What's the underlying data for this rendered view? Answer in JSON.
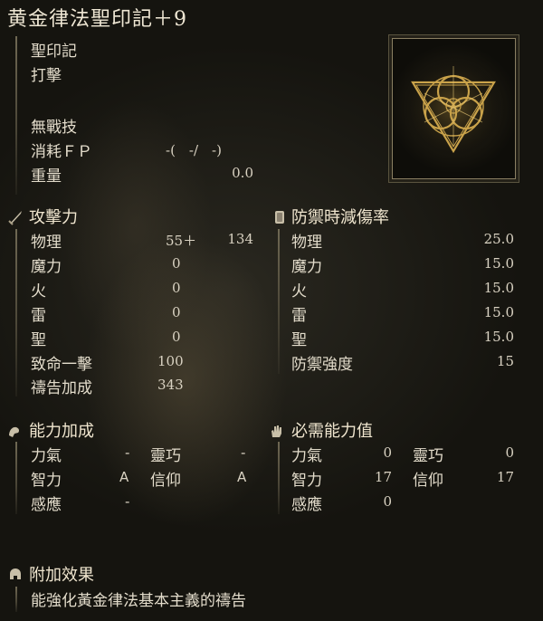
{
  "title": "黄金律法聖印記＋9",
  "item_info": {
    "type": "聖印記",
    "attack_type": "打擊",
    "skill": "無戰技",
    "fp_label": "消耗ＦＰ",
    "fp_value": "-(　-/　-)",
    "weight_label": "重量",
    "weight_value": "0.0"
  },
  "attack": {
    "header": "攻擊力",
    "rows": [
      {
        "label": "物理",
        "value": "55＋",
        "extra": "134"
      },
      {
        "label": "魔力",
        "value": "0"
      },
      {
        "label": "火",
        "value": "0"
      },
      {
        "label": "雷",
        "value": "0"
      },
      {
        "label": "聖",
        "value": "0"
      },
      {
        "label": "致命一擊",
        "value": "100"
      },
      {
        "label": "禱告加成",
        "value": "343"
      }
    ]
  },
  "defense": {
    "header": "防禦時減傷率",
    "rows": [
      {
        "label": "物理",
        "value": "25.0"
      },
      {
        "label": "魔力",
        "value": "15.0"
      },
      {
        "label": "火",
        "value": "15.0"
      },
      {
        "label": "雷",
        "value": "15.0"
      },
      {
        "label": "聖",
        "value": "15.0"
      },
      {
        "label": "防禦強度",
        "value": "15"
      }
    ]
  },
  "scaling": {
    "header": "能力加成",
    "rows": [
      {
        "l1": "力氣",
        "v1": "-",
        "l2": "靈巧",
        "v2": "-"
      },
      {
        "l1": "智力",
        "v1": "A",
        "l2": "信仰",
        "v2": "A"
      },
      {
        "l1": "感應",
        "v1": "-"
      }
    ]
  },
  "requirements": {
    "header": "必需能力值",
    "rows": [
      {
        "l1": "力氣",
        "v1": "0",
        "l2": "靈巧",
        "v2": "0"
      },
      {
        "l1": "智力",
        "v1": "17",
        "l2": "信仰",
        "v2": "17"
      },
      {
        "l1": "感應",
        "v1": "0"
      }
    ]
  },
  "effect": {
    "header": "附加效果",
    "text": "能強化黃金律法基本主義的禱告"
  },
  "icons": {
    "attack": "sword-icon",
    "defense": "shield-icon",
    "scaling": "arm-icon",
    "requirements": "hand-icon",
    "effect": "helmet-icon",
    "item": "golden-order-seal-icon"
  },
  "colors": {
    "gold": "#c9a24a",
    "text": "#e6dfcf"
  }
}
